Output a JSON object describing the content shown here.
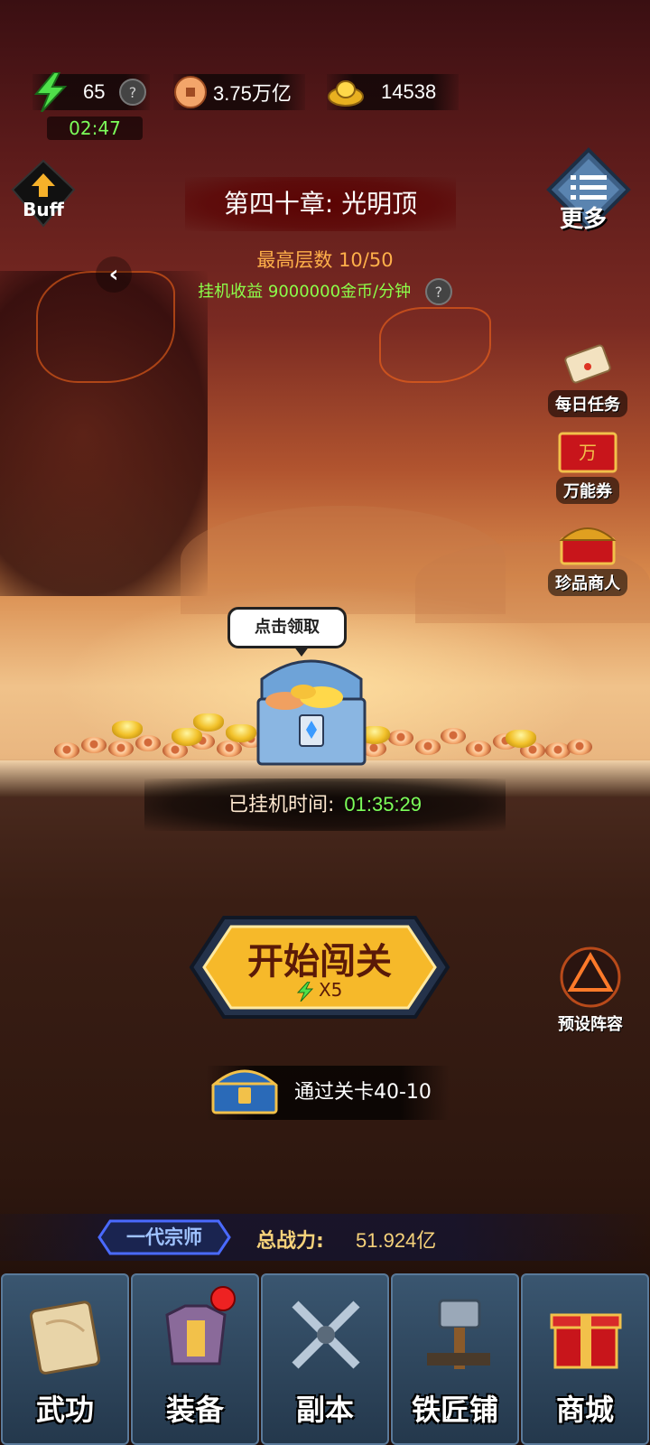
{
  "colors": {
    "accent_green": "#7cff5a",
    "accent_orange": "#ffb04a",
    "gold_text": "#f6d27a"
  },
  "resources": {
    "energy": {
      "icon": "lightning-icon",
      "value": "65",
      "help": "?",
      "timer": "02:47"
    },
    "copper": {
      "icon": "copper-coin-icon",
      "value": "3.75万亿"
    },
    "gold": {
      "icon": "gold-ingot-icon",
      "value": "14538"
    }
  },
  "buff_button": {
    "label": "Buff",
    "icon": "up-arrow-icon"
  },
  "more_button": {
    "label": "更多",
    "icon": "menu-icon"
  },
  "chapter": {
    "title": "第四十章: 光明顶",
    "max_level": "最高层数 10/50",
    "idle_income": "挂机收益 9000000金币/分钟",
    "help": "?"
  },
  "side_buttons": {
    "daily_tasks": "每日任务",
    "voucher": "万能券",
    "voucher_glyph": "万",
    "treasure_merchant": "珍品商人",
    "preset_lineup": "预设阵容"
  },
  "chest_bubble": "点击领取",
  "idle_time": {
    "label": "已挂机时间:",
    "value": "01:35:29"
  },
  "start_button": {
    "label": "开始闯关",
    "cost": "X5"
  },
  "stage_reward": {
    "label": "通过关卡40-10"
  },
  "power": {
    "rank": "一代宗师",
    "label": "总战力:",
    "value": "51.924亿"
  },
  "nav": [
    {
      "label": "武功",
      "icon": "scroll-icon"
    },
    {
      "label": "装备",
      "icon": "armor-icon"
    },
    {
      "label": "副本",
      "icon": "crossed-swords-icon"
    },
    {
      "label": "铁匠铺",
      "icon": "hammer-icon"
    },
    {
      "label": "商城",
      "icon": "gift-box-icon"
    }
  ]
}
